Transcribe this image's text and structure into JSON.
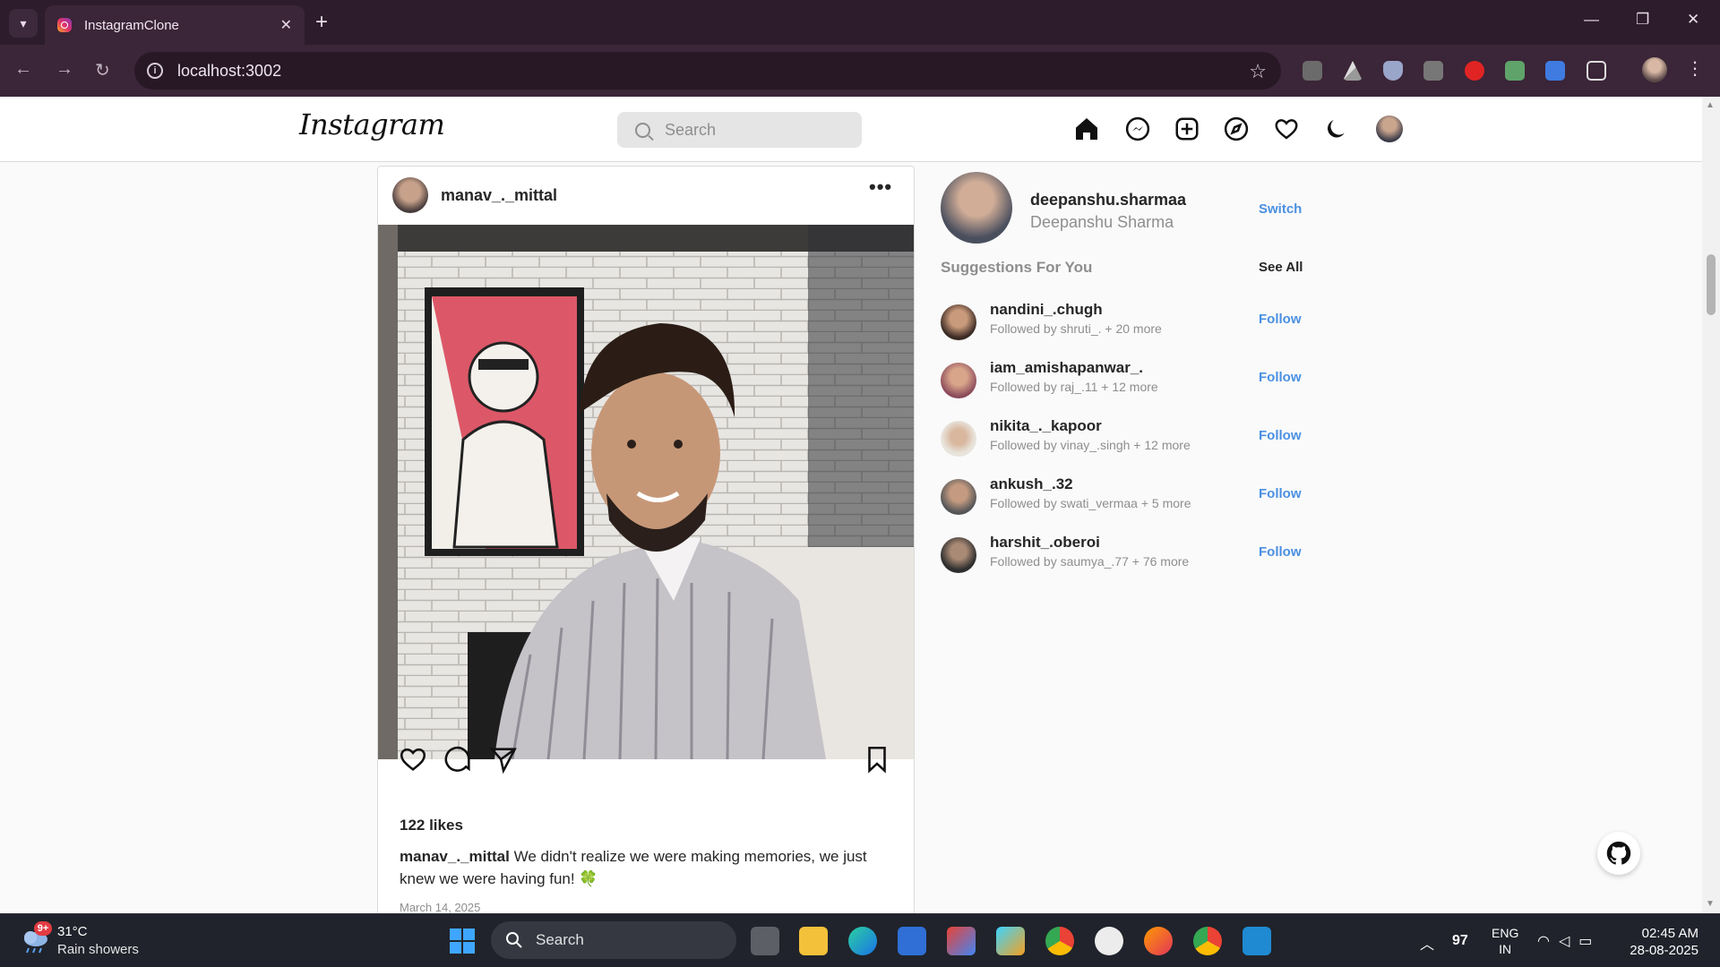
{
  "browser": {
    "tab_title": "InstagramClone",
    "url": "localhost:3002"
  },
  "instagram": {
    "logo": "Instagram",
    "search_placeholder": "Search",
    "post": {
      "username": "manav_._mittal",
      "likes": "122 likes",
      "caption_user": "manav_._mittal",
      "caption_text": "We didn't realize we were making memories, we just knew we were having fun! 🍀",
      "date": "March 14, 2025"
    },
    "sidebar": {
      "username": "deepanshu.sharmaa",
      "name": "Deepanshu Sharma",
      "switch_label": "Switch",
      "suggestions_title": "Suggestions For You",
      "see_all_label": "See All",
      "follow_label": "Follow",
      "suggestions": [
        {
          "username": "nandini_.chugh",
          "followed_by": "Followed by shruti_. + 20 more"
        },
        {
          "username": "iam_amishapanwar_.",
          "followed_by": "Followed by raj_.11 + 12 more"
        },
        {
          "username": "nikita_._kapoor",
          "followed_by": "Followed by vinay_.singh + 12 more"
        },
        {
          "username": "ankush_.32",
          "followed_by": "Followed by swati_vermaa + 5 more"
        },
        {
          "username": "harshit_.oberoi",
          "followed_by": "Followed by saumya_.77 + 76 more"
        }
      ]
    }
  },
  "taskbar": {
    "weather_badge": "9+",
    "temperature": "31°C",
    "weather_desc": "Rain showers",
    "search_label": "Search",
    "tray_number": "97",
    "lang_line1": "ENG",
    "lang_line2": "IN",
    "time": "02:45 AM",
    "date": "28-08-2025"
  },
  "colors": {
    "accent_blue": "#4a90e2",
    "chrome_bg": "#2c1c2c",
    "taskbar_bg": "#20232b"
  }
}
